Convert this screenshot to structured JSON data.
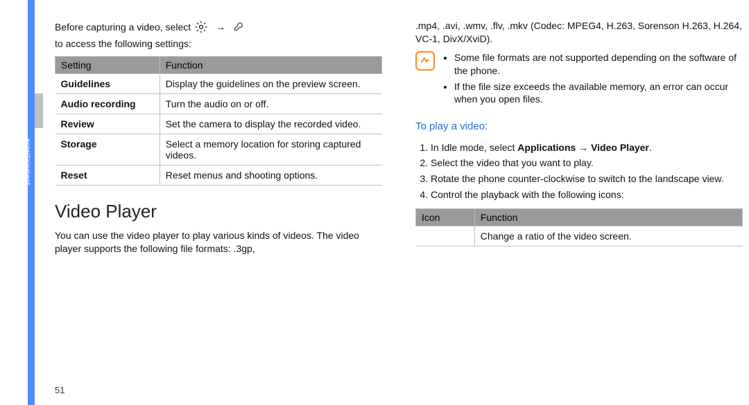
{
  "sidebar_label": "entertainment",
  "page_number": "51",
  "left": {
    "intro_a": "Before capturing a video, select",
    "intro_arrow": "→",
    "intro_b": "to access the following settings:",
    "table_headers": {
      "c1": "Setting",
      "c2": "Function"
    },
    "rows": [
      {
        "s": "Guidelines",
        "f": "Display the guidelines on the preview screen."
      },
      {
        "s": "Audio recording",
        "f": "Turn the audio on or off."
      },
      {
        "s": "Review",
        "f": "Set the camera to display the recorded video."
      },
      {
        "s": "Storage",
        "f": "Select a memory location for storing captured videos."
      },
      {
        "s": "Reset",
        "f": "Reset menus and shooting options."
      }
    ],
    "section_title": "Video Player",
    "section_body": "You can use the video player to play various kinds of videos. The video player supports the following file formats: .3gp,"
  },
  "right": {
    "formats": ".mp4, .avi, .wmv, .flv, .mkv (Codec: MPEG4, H.263, Sorenson H.263, H.264, VC-1, DivX/XviD).",
    "notes": [
      "Some file formats are not supported depending on the software of the phone.",
      "If the file size exceeds the available memory, an error can occur when you open files."
    ],
    "subhead": "To play a video:",
    "steps": {
      "s1a": "In Idle mode, select ",
      "s1b": "Applications → Video Player",
      "s1c": ".",
      "s2": "Select the video that you want to play.",
      "s3": "Rotate the phone counter-clockwise to switch to the landscape view.",
      "s4": "Control the playback with the following icons:"
    },
    "icon_headers": {
      "c1": "Icon",
      "c2": "Function"
    },
    "icon_rows": [
      {
        "i": "",
        "f": "Change a ratio of the video screen."
      }
    ]
  },
  "icons": {
    "gear": "gear-icon",
    "wrench": "wrench-icon",
    "note": "note-icon"
  }
}
